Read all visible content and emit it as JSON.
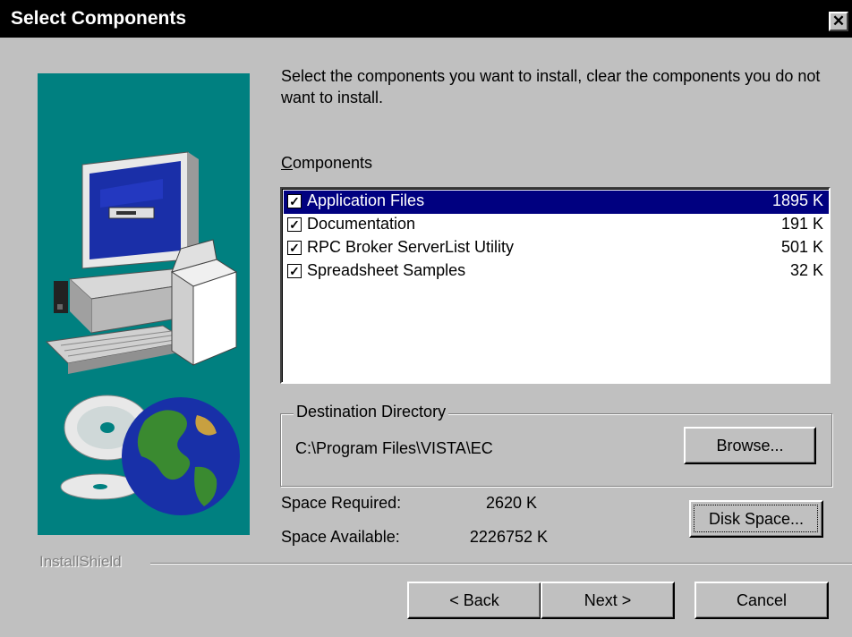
{
  "window": {
    "title": "Select Components",
    "close_icon": "close-icon"
  },
  "instructions": "Select the components you want to install, clear the components you do not want to install.",
  "components": {
    "label": "Components",
    "items": [
      {
        "name": "Application Files",
        "size": "1895 K",
        "checked": true,
        "selected": true
      },
      {
        "name": "Documentation",
        "size": "191 K",
        "checked": true,
        "selected": false
      },
      {
        "name": "RPC Broker ServerList Utility",
        "size": "501 K",
        "checked": true,
        "selected": false
      },
      {
        "name": "Spreadsheet Samples",
        "size": "32 K",
        "checked": true,
        "selected": false
      }
    ]
  },
  "destination": {
    "label": "Destination Directory",
    "path": "C:\\Program Files\\VISTA\\EC",
    "browse_label": "Browse..."
  },
  "space": {
    "required_label": "Space Required:",
    "required_value": "2620 K",
    "available_label": "Space Available:",
    "available_value": "2226752 K",
    "disk_space_label": "Disk Space..."
  },
  "branding": "InstallShield",
  "buttons": {
    "back": "< Back",
    "next": "Next >",
    "cancel": "Cancel"
  },
  "colors": {
    "title_bar": "#000000",
    "selection": "#000080",
    "art_background": "#008080",
    "dialog": "#c0c0c0"
  }
}
